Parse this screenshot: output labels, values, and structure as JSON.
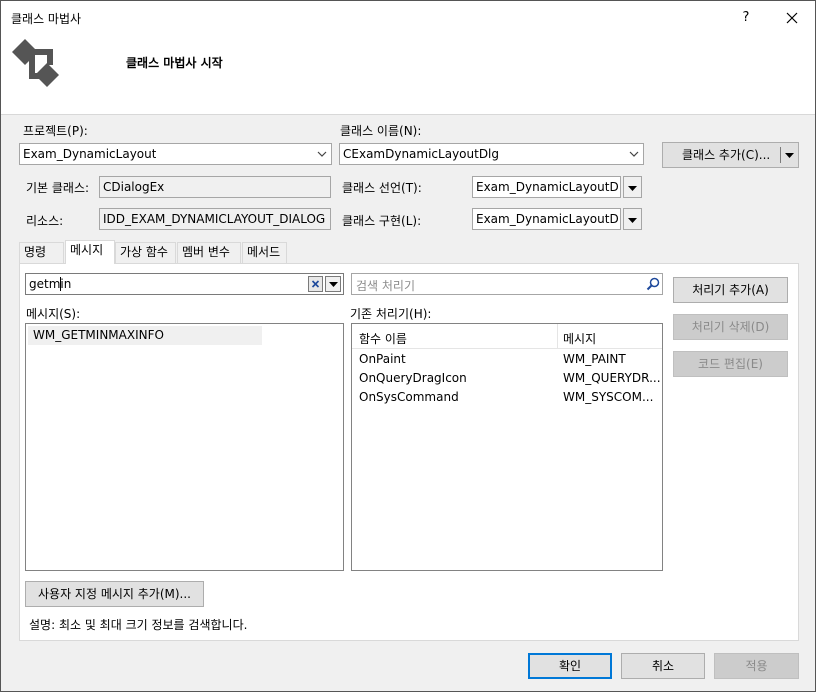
{
  "window": {
    "title": "클래스 마법사",
    "help_label": "?"
  },
  "header": {
    "title": "클래스 마법사 시작",
    "icon": "class-wizard-icon"
  },
  "project": {
    "label": "프로젝트(P):",
    "value": "Exam_DynamicLayout"
  },
  "class_name": {
    "label": "클래스 이름(N):",
    "value": "CExamDynamicLayoutDlg"
  },
  "add_class_button": {
    "label": "클래스 추가(C)..."
  },
  "base_class": {
    "label": "기본 클래스:",
    "value": "CDialogEx"
  },
  "resource": {
    "label": "리소스:",
    "value": "IDD_EXAM_DYNAMICLAYOUT_DIALOG"
  },
  "class_decl": {
    "label": "클래스 선언(T):",
    "value": "Exam_DynamicLayoutDlg."
  },
  "class_impl": {
    "label": "클래스 구현(L):",
    "value": "Exam_DynamicLayoutDlg."
  },
  "tabs": [
    {
      "label": "명령"
    },
    {
      "label": "메시지"
    },
    {
      "label": "가상 함수"
    },
    {
      "label": "멤버 변수"
    },
    {
      "label": "메서드"
    }
  ],
  "filter": {
    "value": "getmin"
  },
  "search": {
    "placeholder": "검색 처리기"
  },
  "messages": {
    "label": "메시지(S):",
    "items": [
      "WM_GETMINMAXINFO"
    ]
  },
  "handlers": {
    "label": "기존 처리기(H):",
    "columns": [
      "함수 이름",
      "메시지"
    ],
    "rows": [
      {
        "func": "OnPaint",
        "msg": "WM_PAINT"
      },
      {
        "func": "OnQueryDragIcon",
        "msg": "WM_QUERYDR..."
      },
      {
        "func": "OnSysCommand",
        "msg": "WM_SYSCOM..."
      }
    ]
  },
  "buttons": {
    "add_handler": "처리기 추가(A)",
    "delete_handler": "처리기 삭제(D)",
    "edit_code": "코드 편집(E)",
    "custom_message": "사용자 지정 메시지 추가(M)...",
    "ok": "확인",
    "cancel": "취소",
    "apply": "적용"
  },
  "description": "설명:  최소 및 최대 크기 정보를 검색합니다.",
  "colors": {
    "accent": "#0078d7",
    "selection": "#f0f0f0"
  }
}
